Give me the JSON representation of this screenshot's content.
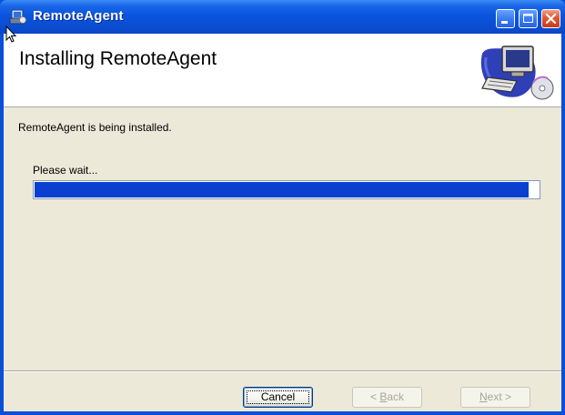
{
  "window": {
    "title": "RemoteAgent",
    "colors": {
      "titlebar": "#0a4fd6",
      "client": "#ece9d8",
      "progress_fill": "#0a3fd0"
    }
  },
  "banner": {
    "title": "Installing RemoteAgent",
    "image_icon": "computer-installer-icon"
  },
  "status": {
    "message": "RemoteAgent is being installed.",
    "wait_label": "Please wait...",
    "progress_fraction": 0.98
  },
  "buttons": {
    "cancel": "Cancel",
    "back_prefix": "< ",
    "back_mnemonic": "B",
    "back_rest": "ack",
    "next_mnemonic": "N",
    "next_rest": "ext >"
  },
  "title_buttons": {
    "minimize_icon": "minimize-icon",
    "maximize_icon": "maximize-icon",
    "close_icon": "close-icon"
  }
}
